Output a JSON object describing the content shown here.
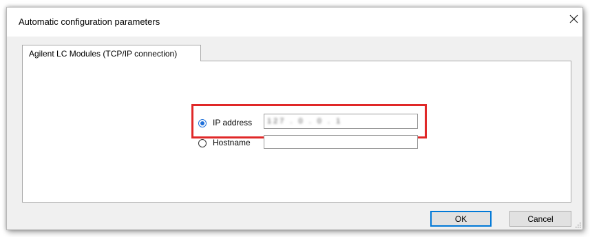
{
  "dialog": {
    "title": "Automatic configuration parameters",
    "close_glyph": "✕"
  },
  "tabs": [
    {
      "label": "Agilent LC Modules (TCP/IP connection)",
      "selected": true
    }
  ],
  "form": {
    "ip_option": {
      "label": "IP address",
      "checked": true,
      "value": "127 . 0 . 0 . 1"
    },
    "hostname_option": {
      "label": "Hostname",
      "checked": false,
      "value": ""
    }
  },
  "buttons": {
    "ok_label": "OK",
    "cancel_label": "Cancel"
  },
  "colors": {
    "highlight": "#e02828",
    "accent": "#1e6fd9",
    "dialog_bg": "#f0f0f0"
  }
}
